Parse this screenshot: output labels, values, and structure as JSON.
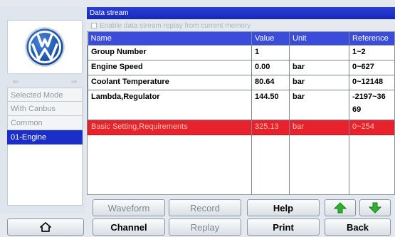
{
  "title": "Data stream",
  "replay_option": "Enable data stream replay from current memory",
  "nav": {
    "left_arrow": "⇐",
    "right_arrow": "⇒"
  },
  "modes": [
    {
      "label": "Selected Mode"
    },
    {
      "label": "With Canbus"
    },
    {
      "label": "Common"
    },
    {
      "label": "01-Engine"
    }
  ],
  "table": {
    "headers": {
      "name": "Name",
      "value": "Value",
      "unit": "Unit",
      "reference": "Reference"
    },
    "rows": [
      {
        "name": "Group Number",
        "value": "1",
        "unit": "",
        "reference": "1~2"
      },
      {
        "name": "Engine Speed",
        "value": "0.00",
        "unit": "bar",
        "reference": "0~627"
      },
      {
        "name": "Coolant Temperature",
        "value": "80.64",
        "unit": "bar",
        "reference": "0~12148"
      },
      {
        "name": "Lambda,Regulator",
        "value": "144.50",
        "unit": "bar",
        "reference": "-2197~36",
        "reference2": "69"
      },
      {
        "name": "Basic Setting,Requirements",
        "value": "325.13",
        "unit": "bar",
        "reference": "0~254"
      }
    ]
  },
  "buttons": {
    "waveform": "Waveform",
    "record": "Record",
    "help": "Help",
    "channel": "Channel",
    "replay": "Replay",
    "print": "Print",
    "back": "Back"
  },
  "colors": {
    "accent": "#1b2fc8",
    "highlight_row": "#e8222c",
    "arrow_green": "#2fb12f"
  }
}
